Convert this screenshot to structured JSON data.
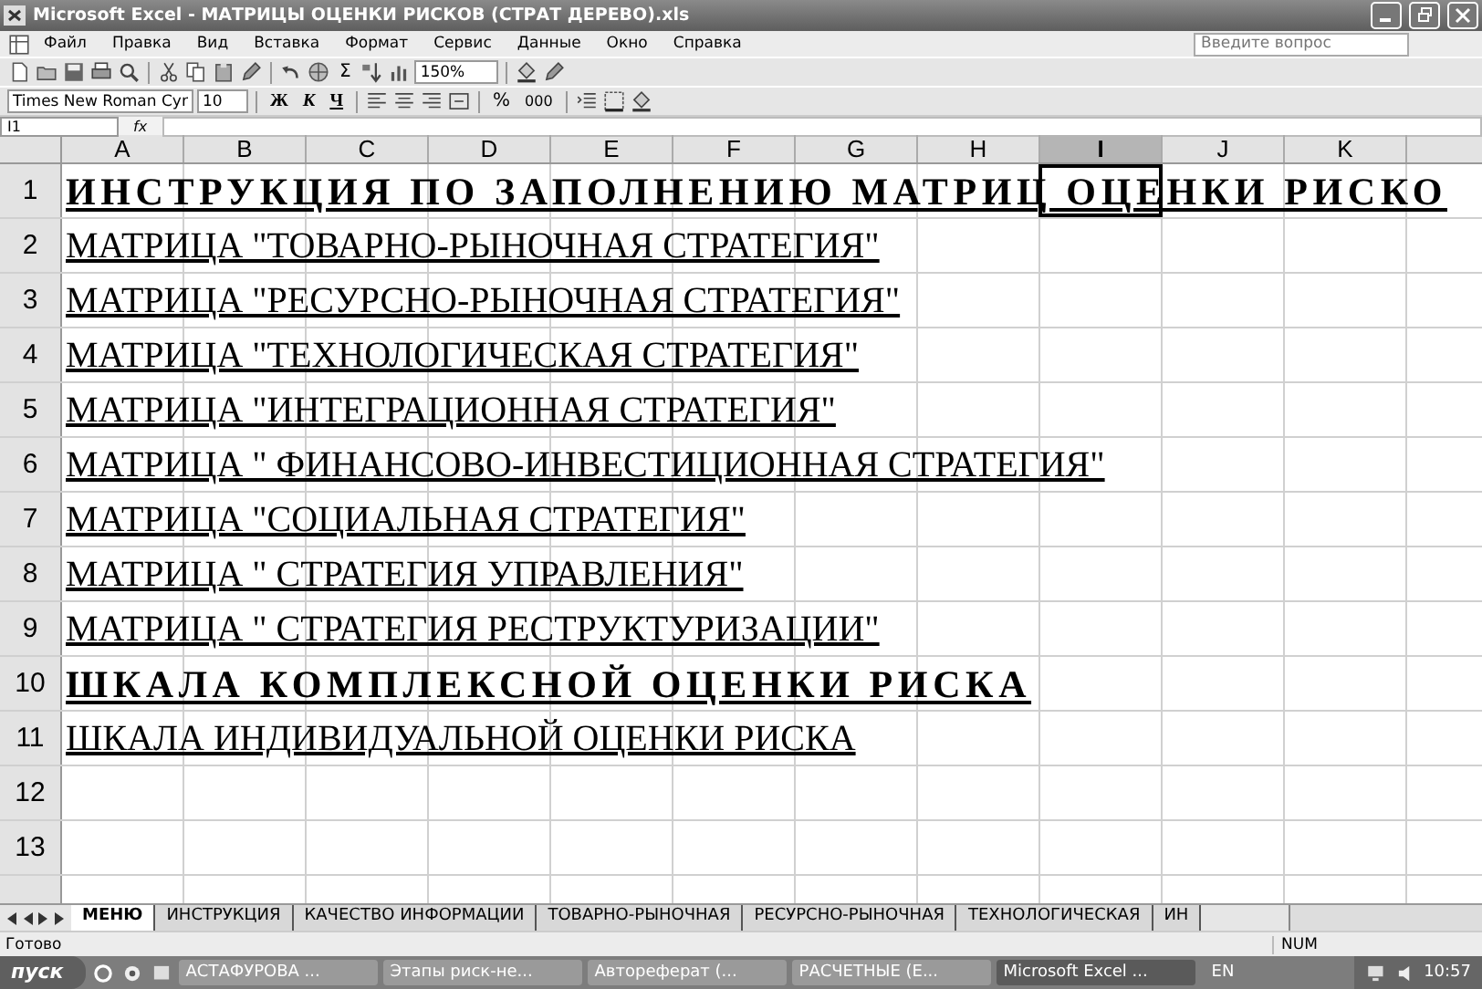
{
  "window": {
    "title": "Microsoft Excel - МАТРИЦЫ ОЦЕНКИ РИСКОВ (СТРАТ ДЕРЕВО).xls"
  },
  "menu": [
    "Файл",
    "Правка",
    "Вид",
    "Вставка",
    "Формат",
    "Сервис",
    "Данные",
    "Окно",
    "Справка"
  ],
  "help_search": {
    "placeholder": "Введите вопрос"
  },
  "standard_toolbar": {
    "autosum": "Σ",
    "zoom": "150%"
  },
  "formatting_toolbar": {
    "font": "Times New Roman Cyr",
    "size": "10",
    "bold": "Ж",
    "italic": "К",
    "underline": "Ч",
    "percent": "%",
    "thousands": "000"
  },
  "formula_bar": {
    "name_box": "I1",
    "fx": "fx"
  },
  "columns": [
    {
      "label": "A",
      "selected": false
    },
    {
      "label": "B",
      "selected": false
    },
    {
      "label": "C",
      "selected": false
    },
    {
      "label": "D",
      "selected": false
    },
    {
      "label": "E",
      "selected": false
    },
    {
      "label": "F",
      "selected": false
    },
    {
      "label": "G",
      "selected": false
    },
    {
      "label": "H",
      "selected": false
    },
    {
      "label": "I",
      "selected": true
    },
    {
      "label": "J",
      "selected": false
    },
    {
      "label": "K",
      "selected": false
    }
  ],
  "rows": [
    {
      "number": "1",
      "text": "ИНСТРУКЦИЯ ПО ЗАПОЛНЕНИЮ МАТРИЦ ОЦЕНКИ РИСКО",
      "bold": true
    },
    {
      "number": "2",
      "text": "МАТРИЦА  \"ТОВАРНО-РЫНОЧНАЯ СТРАТЕГИЯ\"",
      "bold": false
    },
    {
      "number": "3",
      "text": "МАТРИЦА  \"РЕСУРСНО-РЫНОЧНАЯ СТРАТЕГИЯ\"",
      "bold": false
    },
    {
      "number": "4",
      "text": "МАТРИЦА  \"ТЕХНОЛОГИЧЕСКАЯ СТРАТЕГИЯ\"",
      "bold": false
    },
    {
      "number": "5",
      "text": "МАТРИЦА  \"ИНТЕГРАЦИОННАЯ СТРАТЕГИЯ\"",
      "bold": false
    },
    {
      "number": "6",
      "text": "МАТРИЦА \" ФИНАНСОВО-ИНВЕСТИЦИОННАЯ СТРАТЕГИЯ\"",
      "bold": false
    },
    {
      "number": "7",
      "text": "МАТРИЦА \"СОЦИАЛЬНАЯ СТРАТЕГИЯ\"",
      "bold": false
    },
    {
      "number": "8",
      "text": "МАТРИЦА  \" СТРАТЕГИЯ УПРАВЛЕНИЯ\"",
      "bold": false
    },
    {
      "number": "9",
      "text": "МАТРИЦА \" СТРАТЕГИЯ РЕСТРУКТУРИЗАЦИИ\"",
      "bold": false
    },
    {
      "number": "10",
      "text": "ШКАЛА КОМПЛЕКСНОЙ ОЦЕНКИ РИСКА",
      "bold": true
    },
    {
      "number": "11",
      "text": "ШКАЛА ИНДИВИДУАЛЬНОЙ ОЦЕНКИ РИСКА",
      "bold": false
    },
    {
      "number": "12"
    },
    {
      "number": "13"
    }
  ],
  "sheet_tabs": [
    {
      "label": "МЕНЮ",
      "selected": true
    },
    {
      "label": "ИНСТРУКЦИЯ",
      "selected": false
    },
    {
      "label": "КАЧЕСТВО ИНФОРМАЦИИ",
      "selected": false
    },
    {
      "label": "ТОВАРНО-РЫНОЧНАЯ",
      "selected": false
    },
    {
      "label": "РЕСУРСНО-РЫНОЧНАЯ",
      "selected": false
    },
    {
      "label": "ТЕХНОЛОГИЧЕСКАЯ",
      "selected": false
    },
    {
      "label": "ИН",
      "selected": false
    }
  ],
  "status_bar": {
    "status": "Готово",
    "num": "NUM"
  },
  "taskbar": {
    "start": "пуск",
    "items": [
      {
        "label": "АСТАФУРОВА ...",
        "selected": false
      },
      {
        "label": "Этапы риск-не...",
        "selected": false
      },
      {
        "label": "Автореферат (...",
        "selected": false
      },
      {
        "label": "РАСЧЕТНЫЕ (Е...",
        "selected": false
      },
      {
        "label": "Microsoft Excel ...",
        "selected": true
      }
    ],
    "language": "EN",
    "clock": "10:57"
  }
}
